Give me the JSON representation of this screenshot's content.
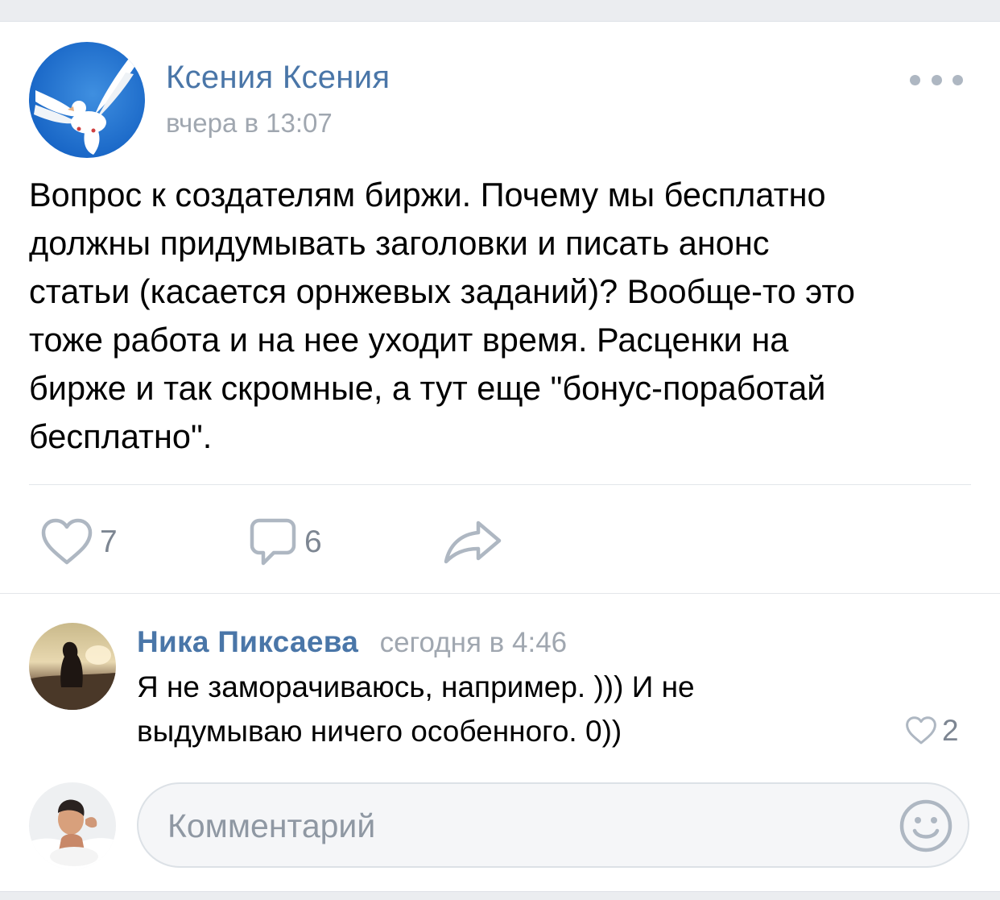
{
  "post": {
    "author": "Ксения Ксения",
    "time": "вчера в 13:07",
    "text": "Вопрос к создателям биржи. Почему мы бесплатно\nдолжны придумывать заголовки и писать анонс\nстатьи (касается орнжевых заданий)? Вообще-то это\nтоже работа и на нее уходит время. Расценки на\nбирже и так скромные,  а тут еще \"бонус-поработай\nбесплатно\".",
    "likes": "7",
    "comments": "6"
  },
  "comment": {
    "author": "Ника Пиксаева",
    "time": "сегодня в 4:46",
    "text": "Я не заморачиваюсь, например. ))) И не\nвыдумываю ничего особенного. 0))",
    "likes": "2"
  },
  "composer": {
    "placeholder": "Комментарий"
  },
  "icons": {
    "more": "more-dots-icon",
    "like": "heart-icon",
    "comment": "comment-bubble-icon",
    "share": "share-arrow-icon",
    "emoji": "smiley-icon"
  },
  "colors": {
    "accent": "#4a76a8",
    "meta": "#a0a7b0",
    "icon": "#aeb7c2"
  }
}
